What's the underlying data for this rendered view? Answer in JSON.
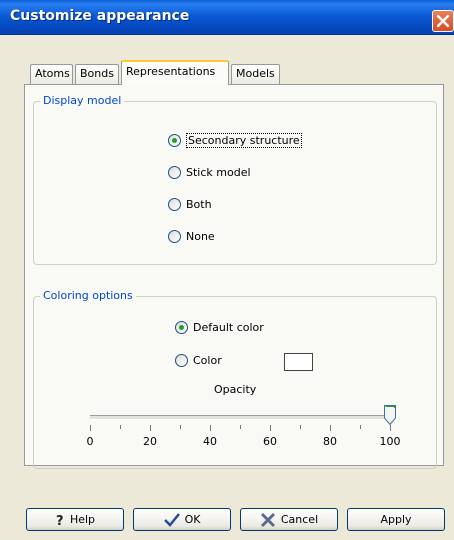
{
  "window": {
    "title": "Customize appearance"
  },
  "tabs": [
    "Atoms",
    "Bonds",
    "Representations",
    "Models"
  ],
  "active_tab": "Representations",
  "display_model": {
    "legend": "Display model",
    "options": [
      "Secondary structure",
      "Stick model",
      "Both",
      "None"
    ],
    "selected": "Secondary structure"
  },
  "coloring": {
    "legend": "Coloring options",
    "options": [
      "Default color",
      "Color"
    ],
    "selected": "Default color",
    "swatch_color": "#ffffff",
    "opacity_label": "Opacity",
    "opacity_value": 100,
    "opacity_range": [
      0,
      100
    ],
    "tick_labels": [
      "0",
      "20",
      "40",
      "60",
      "80",
      "100"
    ]
  },
  "buttons": {
    "help": "Help",
    "ok": "OK",
    "cancel": "Cancel",
    "apply": "Apply"
  },
  "icons": {
    "help": "question-mark",
    "ok": "checkmark",
    "cancel": "x-mark",
    "close": "x"
  },
  "colors": {
    "title_bar": "#0a5ad5",
    "legend_text": "#0046d5",
    "close_button": "#d84b25",
    "radio_dot": "#21a121"
  }
}
